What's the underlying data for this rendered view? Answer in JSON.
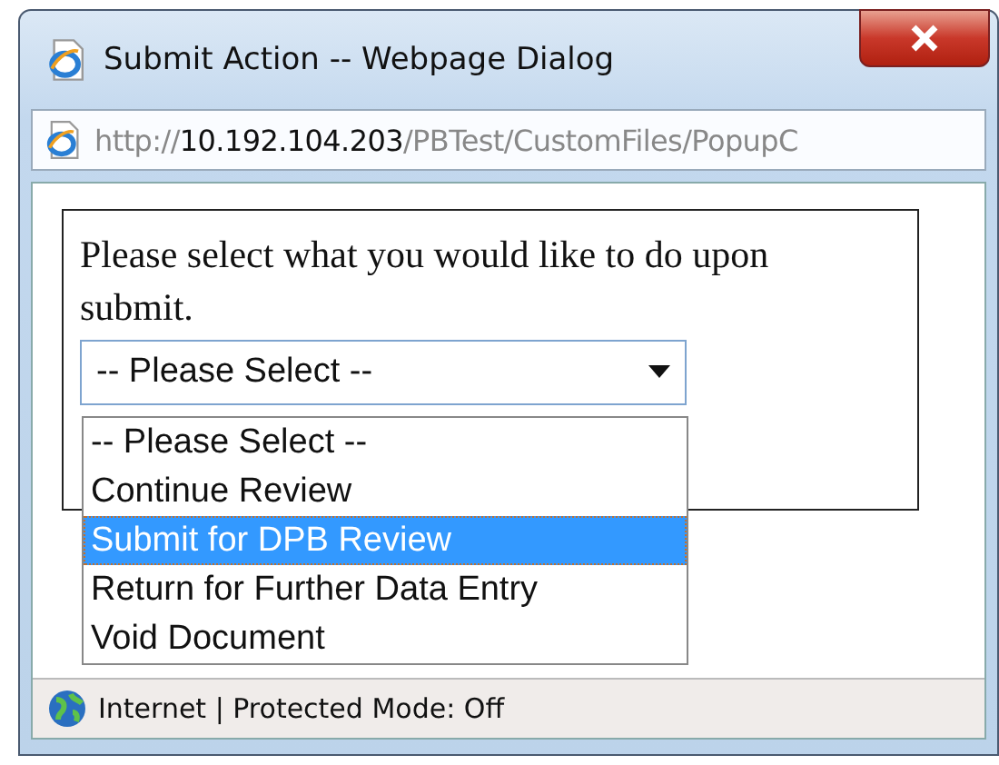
{
  "window": {
    "title": "Submit Action -- Webpage Dialog"
  },
  "address_bar": {
    "scheme": "http://",
    "host": "10.192.104.203",
    "path": "/PBTest/CustomFiles/PopupC"
  },
  "content": {
    "prompt": "Please select what you would like to do upon submit.",
    "select": {
      "value": "-- Please Select --",
      "expanded": true,
      "options": [
        {
          "label": "-- Please Select --",
          "highlighted": false
        },
        {
          "label": "Continue Review",
          "highlighted": false
        },
        {
          "label": "Submit for DPB Review",
          "highlighted": true
        },
        {
          "label": "Return for Further Data Entry",
          "highlighted": false
        },
        {
          "label": "Void Document",
          "highlighted": false
        }
      ]
    }
  },
  "status_bar": {
    "text": "Internet | Protected Mode: Off"
  }
}
